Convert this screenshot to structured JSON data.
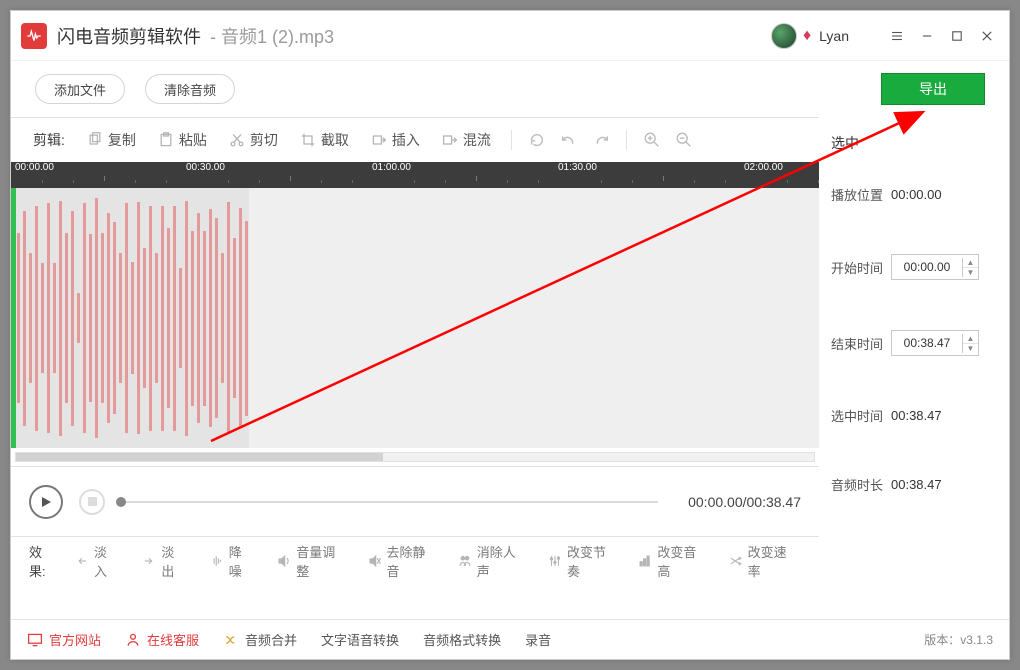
{
  "titlebar": {
    "app_name": "闪电音频剪辑软件",
    "file_name": "音频1 (2).mp3",
    "username": "Lyan"
  },
  "filebar": {
    "add_file": "添加文件",
    "clear_audio": "清除音频",
    "export": "导出"
  },
  "toolbar": {
    "edit_label": "剪辑:",
    "copy": "复制",
    "paste": "粘贴",
    "cut": "剪切",
    "crop": "截取",
    "insert": "插入",
    "mix": "混流"
  },
  "ruler": {
    "t0": "00:00.00",
    "t1": "00:30.00",
    "t2": "01:00.00",
    "t3": "01:30.00",
    "t4": "02:00.00"
  },
  "side": {
    "selected_label": "选中",
    "play_pos_label": "播放位置",
    "play_pos_value": "00:00.00",
    "start_label": "开始时间",
    "start_value": "00:00.00",
    "end_label": "结束时间",
    "end_value": "00:38.47",
    "sel_label": "选中时间",
    "sel_value": "00:38.47",
    "dur_label": "音频时长",
    "dur_value": "00:38.47"
  },
  "player": {
    "time": "00:00.00/00:38.47"
  },
  "effects": {
    "label": "效果:",
    "fade_in": "淡入",
    "fade_out": "淡出",
    "denoise": "降噪",
    "volume": "音量调整",
    "remove_silence": "去除静音",
    "remove_vocal": "消除人声",
    "tempo": "改变节奏",
    "pitch": "改变音高",
    "speed": "改变速率"
  },
  "bottombar": {
    "official": "官方网站",
    "support": "在线客服",
    "merge": "音频合并",
    "tts": "文字语音转换",
    "format": "音频格式转换",
    "record": "录音",
    "version": "版本：v3.1.3"
  }
}
